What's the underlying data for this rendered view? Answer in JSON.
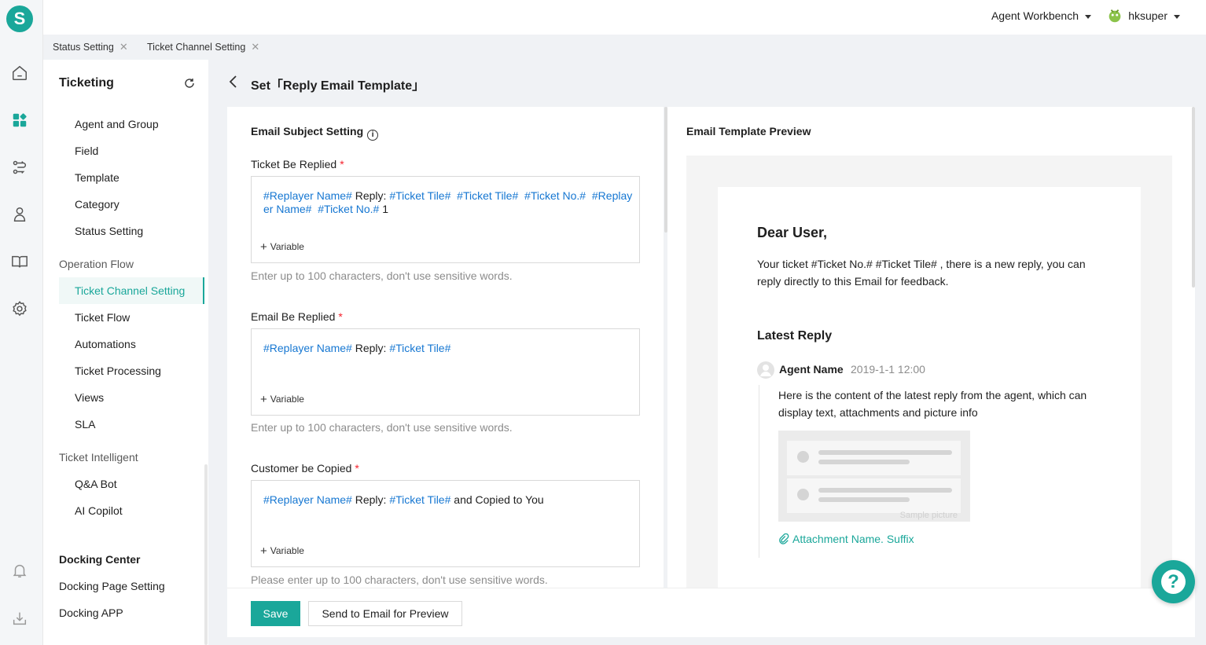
{
  "rail": {
    "logo": "S"
  },
  "topbar": {
    "workbench": "Agent Workbench",
    "user": "hksuper"
  },
  "tabs": [
    {
      "label": "Status Setting"
    },
    {
      "label": "Ticket Channel Setting"
    }
  ],
  "sidebar": {
    "title": "Ticketing",
    "items": [
      {
        "label": "Agent and Group"
      },
      {
        "label": "Field"
      },
      {
        "label": "Template"
      },
      {
        "label": "Category"
      },
      {
        "label": "Status Setting"
      }
    ],
    "group_operation": "Operation Flow",
    "active_item": "Ticket Channel Setting",
    "operation_items": [
      {
        "label": "Ticket Flow"
      },
      {
        "label": "Automations"
      },
      {
        "label": "Ticket Processing"
      },
      {
        "label": "Views"
      },
      {
        "label": "SLA"
      }
    ],
    "group_intelligent": "Ticket Intelligent",
    "intelligent_items": [
      {
        "label": "Q&A Bot"
      },
      {
        "label": "AI Copilot"
      }
    ],
    "docking_head": "Docking Center",
    "docking_items": [
      {
        "label": "Docking Page Setting"
      },
      {
        "label": "Docking APP"
      }
    ]
  },
  "page": {
    "title": "Set「Reply Email Template」"
  },
  "form": {
    "section_title": "Email Subject Setting",
    "add_variable": "Variable",
    "fields": [
      {
        "label": "Ticket Be Replied",
        "parts": [
          {
            "t": "#Replayer Name#",
            "v": true
          },
          {
            "t": " Reply: ",
            "v": false
          },
          {
            "t": "#Ticket Tile#",
            "v": true
          },
          {
            "t": "  ",
            "v": false
          },
          {
            "t": "#Ticket Tile#",
            "v": true
          },
          {
            "t": "  ",
            "v": false
          },
          {
            "t": "#Ticket No.#",
            "v": true
          },
          {
            "t": "  ",
            "v": false
          },
          {
            "t": "#Replayer Name#",
            "v": true
          },
          {
            "t": "  ",
            "v": false
          },
          {
            "t": "#Ticket No.#",
            "v": true
          },
          {
            "t": " 1",
            "v": false
          }
        ],
        "hint": "Enter up to 100 characters, don't use sensitive words."
      },
      {
        "label": "Email Be Replied",
        "parts": [
          {
            "t": "#Replayer Name#",
            "v": true
          },
          {
            "t": " Reply: ",
            "v": false
          },
          {
            "t": "#Ticket Tile#",
            "v": true
          }
        ],
        "hint": "Enter up to 100 characters, don't use sensitive words."
      },
      {
        "label": "Customer be Copied",
        "parts": [
          {
            "t": "#Replayer Name#",
            "v": true
          },
          {
            "t": " Reply: ",
            "v": false
          },
          {
            "t": "#Ticket Tile#",
            "v": true
          },
          {
            "t": " and Copied to You",
            "v": false
          }
        ],
        "hint": "Please enter up to 100 characters, don't use sensitive words."
      }
    ]
  },
  "footer": {
    "save": "Save",
    "preview": "Send to Email for Preview"
  },
  "preview": {
    "title": "Email Template Preview",
    "greeting": "Dear User,",
    "body": "Your ticket #Ticket No.# #Ticket Tile# , there is a new reply, you can reply directly to this Email for feedback.",
    "latest_reply": "Latest Reply",
    "agent_name": "Agent Name",
    "time": "2019-1-1 12:00",
    "reply_text": "Here is the content of the latest reply from the agent, which can display text, attachments and picture info",
    "sample_picture": "Sample picture",
    "attachment": "Attachment Name. Suffix"
  },
  "help": {
    "label": "?"
  },
  "colors": {
    "accent": "#1aa79a",
    "variable": "#1677d2",
    "required": "#f5222d"
  }
}
